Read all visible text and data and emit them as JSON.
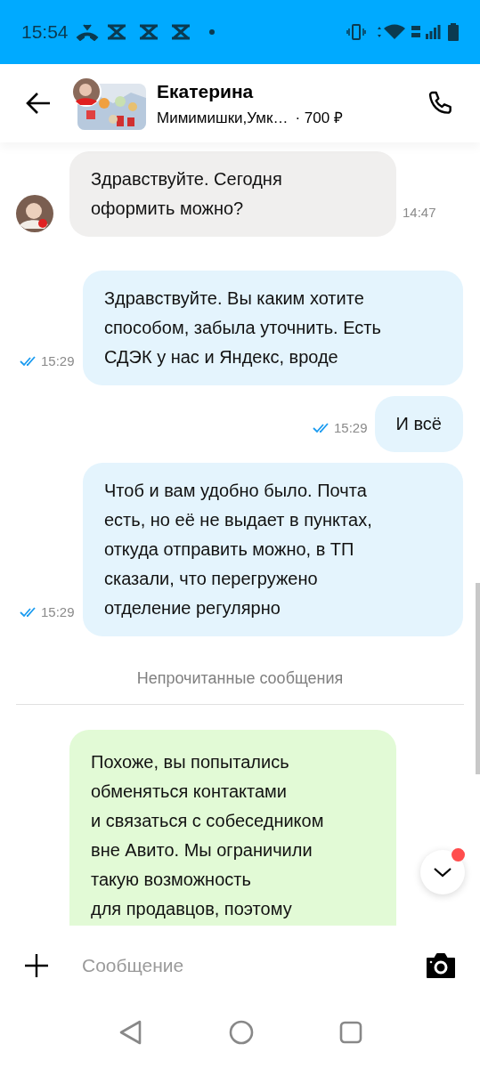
{
  "status_bar": {
    "time": "15:54"
  },
  "header": {
    "name": "Екатерина",
    "item": "Мимимишки,Умк…",
    "price": "· 700 ₽"
  },
  "messages": [
    {
      "kind": "incoming",
      "lines": [
        "Здравствуйте. Сегодня",
        "оформить можно?"
      ],
      "time": "14:47"
    },
    {
      "kind": "outgoing",
      "lines": [
        "Здравствуйте. Вы каким хотите",
        "способом, забыла уточнить. Есть",
        "СДЭК у нас и Яндекс, вроде"
      ],
      "time": "15:29",
      "read": true
    },
    {
      "kind": "outgoing",
      "lines": [
        "И всё"
      ],
      "time": "15:29",
      "read": true
    },
    {
      "kind": "outgoing",
      "lines": [
        "Чтоб и вам удобно было. Почта",
        "есть, но её не выдает в пунктах,",
        "откуда отправить можно, в ТП",
        "сказали, что перегружено",
        "отделение регулярно"
      ],
      "time": "15:29",
      "read": true
    },
    {
      "kind": "divider",
      "text": "Непрочитанные сообщения"
    },
    {
      "kind": "system",
      "lines": [
        "Похоже, вы попытались",
        "обменяться контактами",
        "и связаться с собеседником",
        "вне Авито. Мы ограничили",
        "такую возможность",
        "для продавцов, поэтому"
      ]
    }
  ],
  "scroll_down": {
    "unread": true
  },
  "composer": {
    "placeholder": "Сообщение"
  }
}
